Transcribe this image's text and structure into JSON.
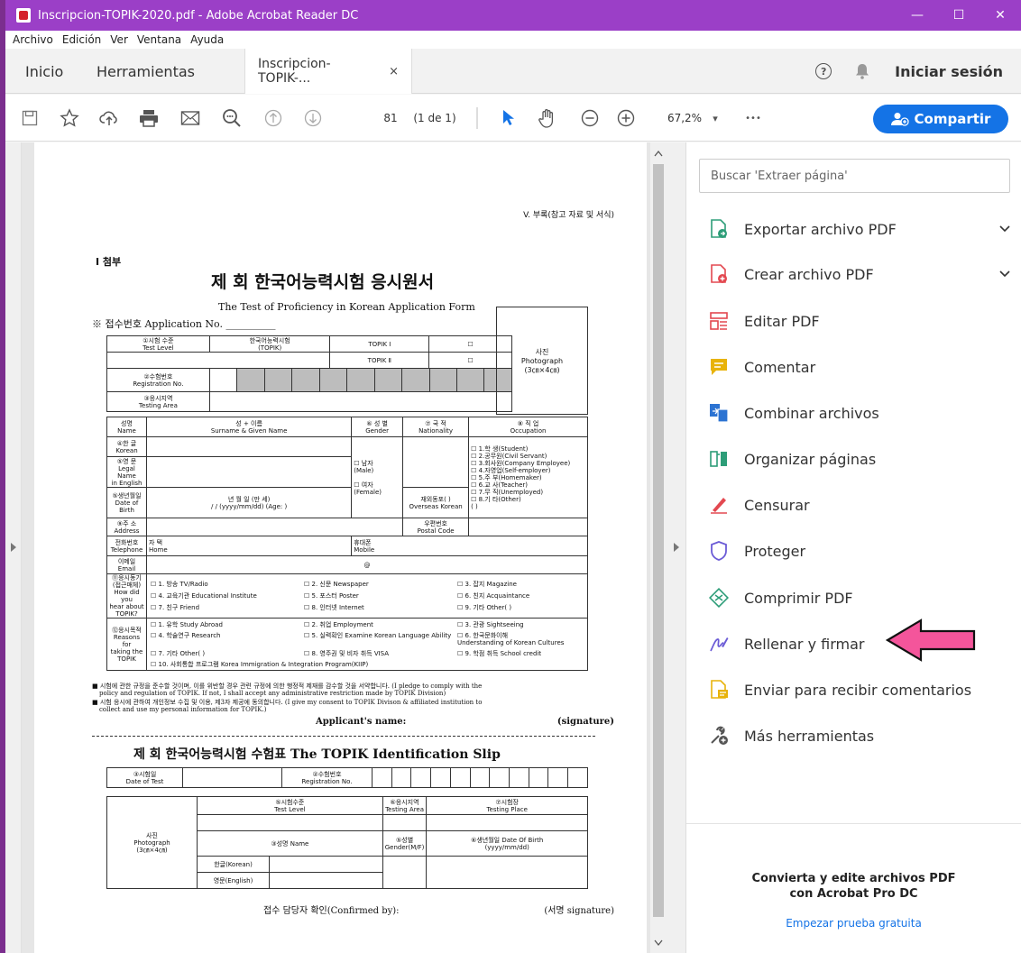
{
  "window": {
    "title": "Inscripcion-TOPIK-2020.pdf - Adobe Acrobat Reader DC",
    "minimize": "—",
    "maximize": "☐",
    "close": "✕"
  },
  "menu": [
    "Archivo",
    "Edición",
    "Ver",
    "Ventana",
    "Ayuda"
  ],
  "tabs": {
    "home": "Inicio",
    "tools": "Herramientas",
    "doc": "Inscripcion-TOPIK-...",
    "close": "×",
    "help": "?",
    "signin": "Iniciar sesión"
  },
  "toolbar": {
    "page_current": "81",
    "page_total": "(1 de 1)",
    "zoom": "67,2%",
    "zoom_arrow": "▾",
    "more": "•••",
    "share": "Compartir"
  },
  "panel": {
    "search_placeholder": "Buscar 'Extraer página'",
    "tools": [
      {
        "label": "Exportar archivo PDF",
        "icon": "export-pdf-icon",
        "color": "#2d9d78"
      },
      {
        "label": "Crear archivo PDF",
        "icon": "create-pdf-icon",
        "color": "#e34850"
      },
      {
        "label": "Editar PDF",
        "icon": "edit-pdf-icon",
        "color": "#e34850"
      },
      {
        "label": "Comentar",
        "icon": "comment-icon",
        "color": "#e8b30a"
      },
      {
        "label": "Combinar archivos",
        "icon": "combine-files-icon",
        "color": "#2c73d2"
      },
      {
        "label": "Organizar páginas",
        "icon": "organize-pages-icon",
        "color": "#2d9d78"
      },
      {
        "label": "Censurar",
        "icon": "redact-icon",
        "color": "#e34850"
      },
      {
        "label": "Proteger",
        "icon": "protect-shield-icon",
        "color": "#6b5bd6"
      },
      {
        "label": "Comprimir PDF",
        "icon": "compress-pdf-icon",
        "color": "#2d9d78"
      },
      {
        "label": "Rellenar y firmar",
        "icon": "fill-sign-icon",
        "color": "#6b5bd6"
      },
      {
        "label": "Enviar para recibir comentarios",
        "icon": "send-comments-icon",
        "color": "#e8b30a"
      },
      {
        "label": "Más herramientas",
        "icon": "more-tools-icon",
        "color": "#555555"
      }
    ],
    "promo_text": "Convierta y edite archivos PDF\ncon Acrobat Pro DC",
    "promo_link": "Empezar prueba gratuita"
  },
  "form": {
    "header_right": "V. 부록(참고 자료 및 서식)",
    "attach": "Ⅰ 첨부",
    "title_ko": "제     회 한국어능력시험 응시원서",
    "title_en": "The    Test of Proficiency in Korean Application Form",
    "app_no": "※ 접수번호 Application No. __________",
    "r1": [
      "①시험 수준\nTest Level",
      "한국어능력시험\n(TOPIK)",
      "TOPIK Ⅰ",
      "☐",
      "사진\nPhotograph\n(3㎝×4㎝)"
    ],
    "r1b": [
      "TOPIK Ⅱ",
      "☐"
    ],
    "r2": "②수험번호\nRegistration No.",
    "r3": "③응시지역\nTesting Area",
    "hdr": [
      "성명\nName",
      "성 + 이름\nSurname & Given Name",
      "⑥ 성 별\nGender",
      "⑦ 국 적\nNationality",
      "⑧ 직 업\nOccupation"
    ],
    "korean": "④한 글\nKorean",
    "legal": "⑤영 문\nLegal Name\nin English",
    "gender": "☐ 남자\n(Male)\n\n☐ 여자\n(Female)",
    "occupation": "☐ 1.학 생(Student)\n☐ 2.공무원(Civil Servant)\n☐ 3.회사원(Company Employee)\n☐ 4.자영업(Self-employer)\n☐ 5.주 부(Homemaker)\n☐ 6.교 사(Teacher)\n☐ 7.무 직(Unemployed)\n☐ 8.기 타(Other)\n(               )",
    "dob": "⑤생년월일\nDate of Birth",
    "dob_val": "년   월   일 (만   세)\n/     /    (yyyy/mm/dd) (Age:    )",
    "overseas": "재외동포(    )\nOverseas Korean",
    "address": "⑨주 소\nAddress",
    "postal": "우편번호\nPostal Code",
    "telephone": "전화번호\nTelephone",
    "home": "자 택\nHome",
    "mobile": "휴대폰\nMobile",
    "email": "이메일\nEmail",
    "at": "@",
    "motive": "⑪응시동기\n(접근매체)\nHow did you\nhear about\nTOPIK?",
    "m1": "☐ 1. 방송 TV/Radio",
    "m2": "☐ 2. 신문 Newspaper",
    "m3": "☐ 3. 잡지 Magazine",
    "m4": "☐ 4. 교육기관 Educational Institute",
    "m5": "☐ 5. 포스터  Poster",
    "m6": "☐ 6. 친지 Acquaintance",
    "m7": "☐ 7. 친구 Friend",
    "m8": "☐ 8. 인터넷 Internet",
    "m9": "☐ 9. 기타 Other(          )",
    "purpose": "⑫응시목적\nReasons for\ntaking the\nTOPIK",
    "p1": "☐ 1. 유학 Study Abroad",
    "p2": "☐ 2. 취업 Employment",
    "p3": "☐ 3. 관광 Sightseeing",
    "p4": "☐ 4. 학술연구 Research",
    "p5": "☐ 5. 실력확인 Examine Korean Language Ability",
    "p6": "☐ 6. 한국문화이해\nUnderstanding of Korean Cultures",
    "p7": "☐ 7. 기타 Other(          )",
    "p8": "☐ 8. 영주권 및 비자 취득 VISA",
    "p9": "☐ 9. 학점 취득 School credit",
    "p10": "☐ 10. 사회통합 프로그램 Korea Immigration & Integration Program(KIIP)",
    "pledge1": "■ 시험에 관한 규정을 준수할 것이며, 이를 위반할 경우 관련 규정에 의한 행정적 제재를 감수할 것을 서약합니다. (I pledge to comply with the",
    "pledge2": "policy and regulation of TOPIK. If not, I shall accept any administrative restriction made by TOPIK Division)",
    "pledge3": "■ 시험 응시에 관하여 개인정보 수집 및 이용, 제3자 제공에 동의합니다. (I give my consent to TOPIK Divison & affiliated institution to",
    "pledge4": "collect and use my personal information for TOPIK.)",
    "applicant": "Applicant's name:",
    "signature": "(signature)",
    "slip_title": "제     회 한국어능력시험 수험표  The      TOPIK Identification Slip",
    "s_date": "③시험일\nDate of Test",
    "s_reg": "②수험번호\nRegistration No.",
    "s_photo": "사진\nPhotograph\n(3㎝×4㎝)",
    "s_level": "⑤시험수준\nTest Level",
    "s_area": "⑥응시지역\nTesting Area",
    "s_place": "⑦시험장\nTesting Place",
    "s_name": "③성명 Name",
    "s_gender": "⑤성별\nGender(M/F)",
    "s_dob": "⑥생년월일 Date Of Birth\n(yyyy/mm/dd)",
    "s_kor": "한글(Korean)",
    "s_eng": "영문(English)",
    "confirm": "접수 담당자 확인(Confirmed by):",
    "confirm_sig": "(서명 signature)"
  }
}
